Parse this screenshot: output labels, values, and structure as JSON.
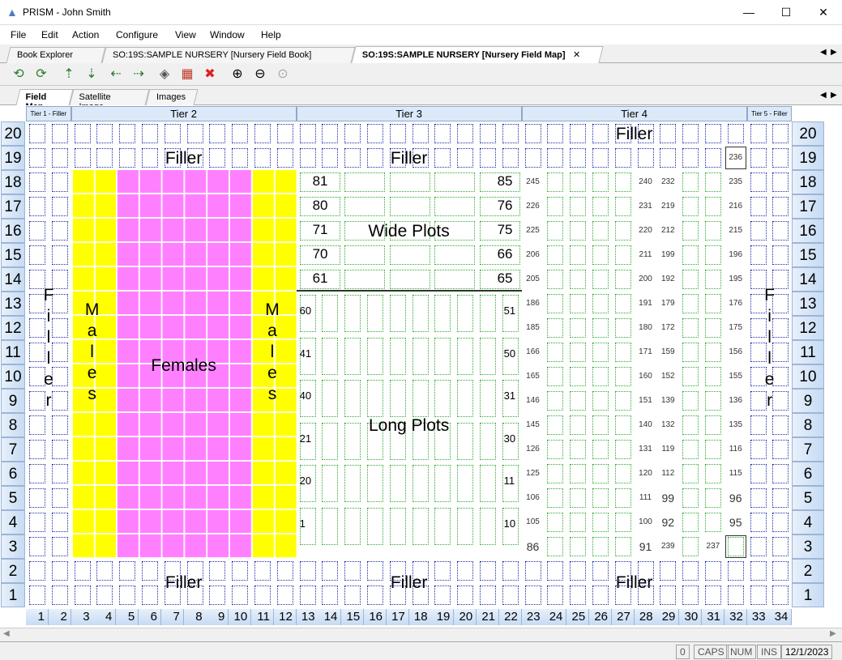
{
  "window": {
    "title": "PRISM - John Smith"
  },
  "menu": [
    "File",
    "Edit",
    "Action",
    "Configure",
    "View",
    "Window",
    "Help"
  ],
  "doc_tabs": [
    {
      "label": "Book Explorer",
      "active": false
    },
    {
      "label": "SO:19S:SAMPLE NURSERY [Nursery Field Book]",
      "active": false
    },
    {
      "label": "SO:19S:SAMPLE NURSERY [Nursery Field Map]",
      "active": true
    }
  ],
  "view_tabs": [
    {
      "label": "Field Map",
      "active": true
    },
    {
      "label": "Satellite Image",
      "active": false
    },
    {
      "label": "Images",
      "active": false
    }
  ],
  "tiers": [
    "Tier 1 - Filler",
    "Tier 2",
    "Tier 3",
    "Tier 4",
    "Tier 5 - Filler"
  ],
  "rows": [
    20,
    19,
    18,
    17,
    16,
    15,
    14,
    13,
    12,
    11,
    10,
    9,
    8,
    7,
    6,
    5,
    4,
    3,
    2,
    1
  ],
  "columns": [
    1,
    2,
    3,
    4,
    5,
    6,
    7,
    8,
    9,
    10,
    11,
    12,
    13,
    14,
    15,
    16,
    17,
    18,
    19,
    20,
    21,
    22,
    23,
    24,
    25,
    26,
    27,
    28,
    29,
    30,
    31,
    32,
    33,
    34
  ],
  "labels": {
    "filler": "Filler",
    "males": "Males",
    "females": "Females",
    "wide_plots": "Wide Plots",
    "long_plots": "Long Plots",
    "filler_vertical": "Filler"
  },
  "wide_plot_numbers": [
    {
      "left": "81",
      "right": "85"
    },
    {
      "left": "80",
      "right": "76"
    },
    {
      "left": "71",
      "right": "75"
    },
    {
      "left": "70",
      "right": "66"
    },
    {
      "left": "61",
      "right": "65"
    }
  ],
  "long_plot_numbers": [
    {
      "left": "60",
      "right": "51"
    },
    {
      "left": "41",
      "right": "50"
    },
    {
      "left": "40",
      "right": "31"
    },
    {
      "left": "21",
      "right": "30"
    },
    {
      "left": "20",
      "right": "11"
    },
    {
      "left": "1",
      "right": "10"
    }
  ],
  "tier4_plots": [
    {
      "row": 19,
      "c32": "236"
    },
    {
      "row": 18,
      "c23": "245",
      "c28": "240",
      "c29": "232",
      "c32": "235"
    },
    {
      "row": 17,
      "c23": "226",
      "c28": "231",
      "c29": "219",
      "c32": "216"
    },
    {
      "row": 16,
      "c23": "225",
      "c28": "220",
      "c29": "212",
      "c32": "215"
    },
    {
      "row": 15,
      "c23": "206",
      "c28": "211",
      "c29": "199",
      "c32": "196"
    },
    {
      "row": 14,
      "c23": "205",
      "c28": "200",
      "c29": "192",
      "c32": "195"
    },
    {
      "row": 13,
      "c23": "186",
      "c28": "191",
      "c29": "179",
      "c32": "176"
    },
    {
      "row": 12,
      "c23": "185",
      "c28": "180",
      "c29": "172",
      "c32": "175"
    },
    {
      "row": 11,
      "c23": "166",
      "c28": "171",
      "c29": "159",
      "c32": "156"
    },
    {
      "row": 10,
      "c23": "165",
      "c28": "160",
      "c29": "152",
      "c32": "155"
    },
    {
      "row": 9,
      "c23": "146",
      "c28": "151",
      "c29": "139",
      "c32": "136"
    },
    {
      "row": 8,
      "c23": "145",
      "c28": "140",
      "c29": "132",
      "c32": "135"
    },
    {
      "row": 7,
      "c23": "126",
      "c28": "131",
      "c29": "119",
      "c32": "116"
    },
    {
      "row": 6,
      "c23": "125",
      "c28": "120",
      "c29": "112",
      "c32": "115"
    },
    {
      "row": 5,
      "c23": "106",
      "c28": "111",
      "c29": "99",
      "c32": "96"
    },
    {
      "row": 4,
      "c23": "105",
      "c28": "100",
      "c29": "92",
      "c32": "95"
    },
    {
      "row": 3,
      "c23": "86",
      "c28": "91",
      "c29": "239",
      "c31": "237"
    }
  ],
  "status": {
    "count": "0",
    "caps": "CAPS",
    "num": "NUM",
    "ins": "INS",
    "date": "12/1/2023"
  },
  "colors": {
    "males": "#ffff00",
    "females": "#ff80ff",
    "grid": "#1a2aa8",
    "green_grid": "#2eaa2e",
    "header": "#dce9f8"
  }
}
